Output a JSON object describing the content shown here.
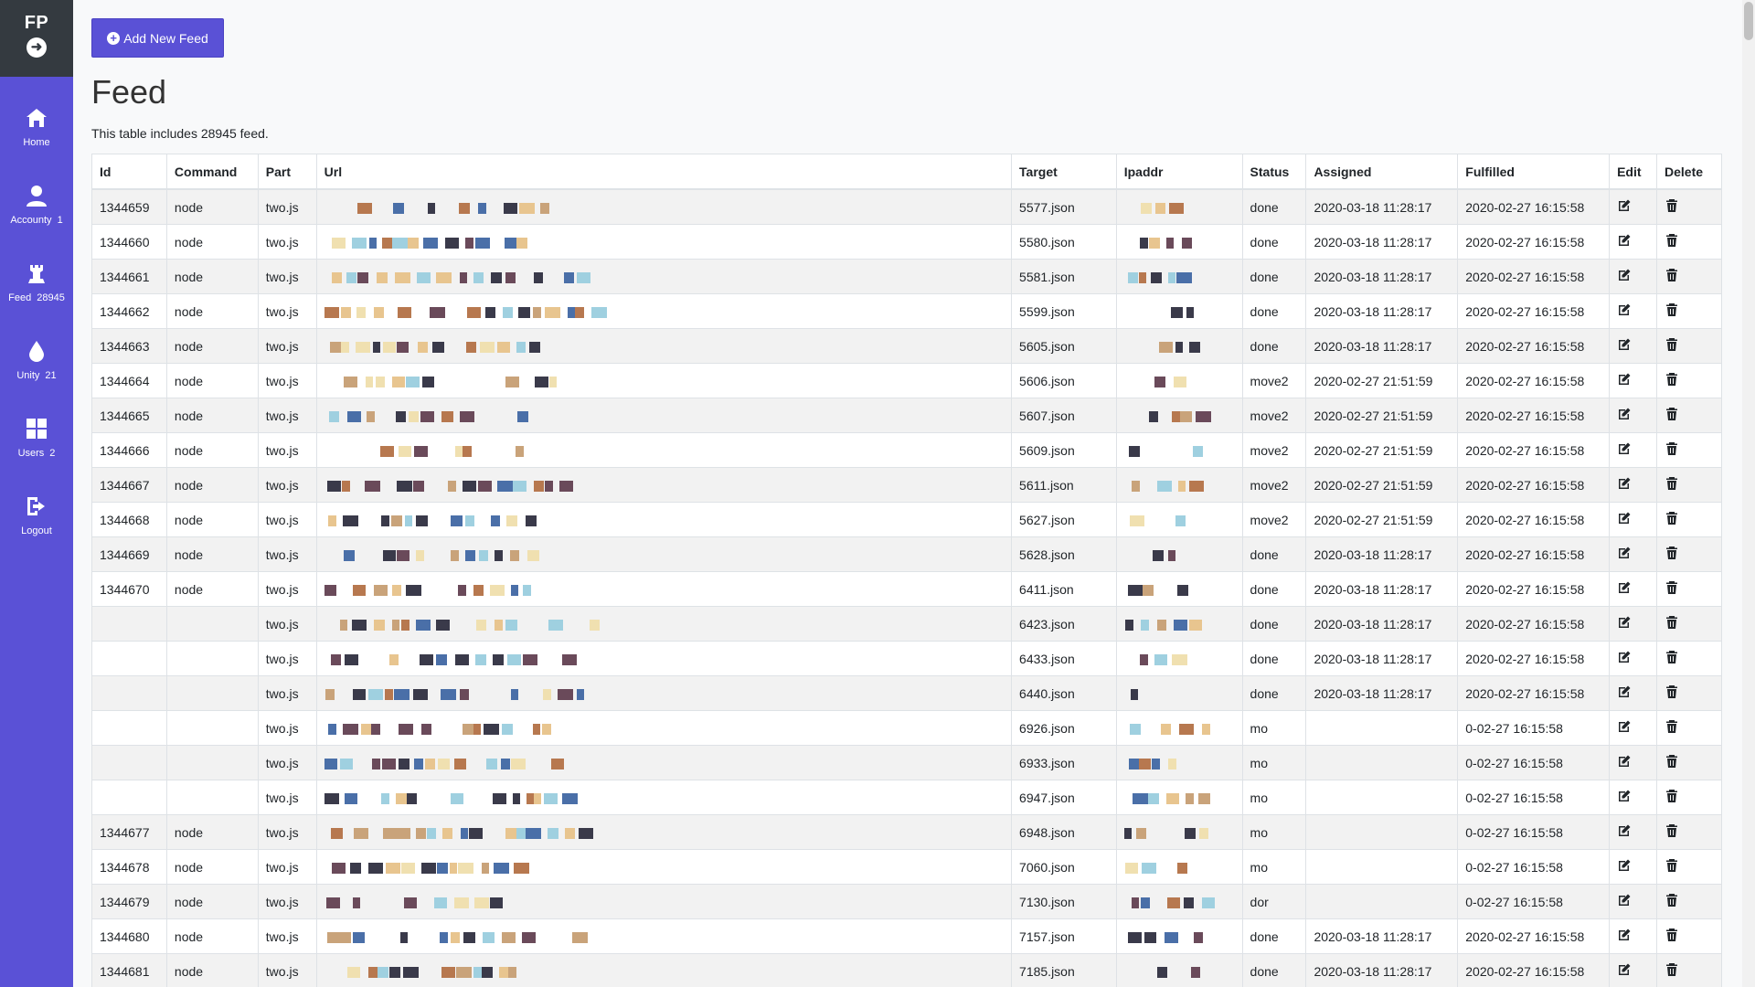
{
  "brand": {
    "title": "FP"
  },
  "nav": [
    {
      "label": "Home",
      "icon": "home-icon",
      "badge": ""
    },
    {
      "label": "Accounty",
      "icon": "user-icon",
      "badge": "1"
    },
    {
      "label": "Feed",
      "icon": "chess-rook-icon",
      "badge": "28945"
    },
    {
      "label": "Unity",
      "icon": "drop-icon",
      "badge": "21"
    },
    {
      "label": "Users",
      "icon": "grid-icon",
      "badge": "2"
    },
    {
      "label": "Logout",
      "icon": "logout-icon",
      "badge": ""
    }
  ],
  "toolbar": {
    "add_label": "Add New Feed"
  },
  "page": {
    "title": "Feed",
    "subtitle": "This table includes 28945 feed."
  },
  "table": {
    "headers": [
      "Id",
      "Command",
      "Part",
      "Url",
      "Target",
      "Ipaddr",
      "Status",
      "Assigned",
      "Fulfilled",
      "Edit",
      "Delete"
    ],
    "rows": [
      {
        "id": "1344659",
        "command": "node",
        "part": "two.js",
        "target": "5577.json",
        "status": "done",
        "assigned": "2020-03-18 11:28:17",
        "fulfilled": "2020-02-27 16:15:58"
      },
      {
        "id": "1344660",
        "command": "node",
        "part": "two.js",
        "target": "5580.json",
        "status": "done",
        "assigned": "2020-03-18 11:28:17",
        "fulfilled": "2020-02-27 16:15:58"
      },
      {
        "id": "1344661",
        "command": "node",
        "part": "two.js",
        "target": "5581.json",
        "status": "done",
        "assigned": "2020-03-18 11:28:17",
        "fulfilled": "2020-02-27 16:15:58"
      },
      {
        "id": "1344662",
        "command": "node",
        "part": "two.js",
        "target": "5599.json",
        "status": "done",
        "assigned": "2020-03-18 11:28:17",
        "fulfilled": "2020-02-27 16:15:58"
      },
      {
        "id": "1344663",
        "command": "node",
        "part": "two.js",
        "target": "5605.json",
        "status": "done",
        "assigned": "2020-03-18 11:28:17",
        "fulfilled": "2020-02-27 16:15:58"
      },
      {
        "id": "1344664",
        "command": "node",
        "part": "two.js",
        "target": "5606.json",
        "status": "move2",
        "assigned": "2020-02-27 21:51:59",
        "fulfilled": "2020-02-27 16:15:58"
      },
      {
        "id": "1344665",
        "command": "node",
        "part": "two.js",
        "target": "5607.json",
        "status": "move2",
        "assigned": "2020-02-27 21:51:59",
        "fulfilled": "2020-02-27 16:15:58"
      },
      {
        "id": "1344666",
        "command": "node",
        "part": "two.js",
        "target": "5609.json",
        "status": "move2",
        "assigned": "2020-02-27 21:51:59",
        "fulfilled": "2020-02-27 16:15:58"
      },
      {
        "id": "1344667",
        "command": "node",
        "part": "two.js",
        "target": "5611.json",
        "status": "move2",
        "assigned": "2020-02-27 21:51:59",
        "fulfilled": "2020-02-27 16:15:58"
      },
      {
        "id": "1344668",
        "command": "node",
        "part": "two.js",
        "target": "5627.json",
        "status": "move2",
        "assigned": "2020-02-27 21:51:59",
        "fulfilled": "2020-02-27 16:15:58"
      },
      {
        "id": "1344669",
        "command": "node",
        "part": "two.js",
        "target": "5628.json",
        "status": "done",
        "assigned": "2020-03-18 11:28:17",
        "fulfilled": "2020-02-27 16:15:58"
      },
      {
        "id": "1344670",
        "command": "node",
        "part": "two.js",
        "target": "6411.json",
        "status": "done",
        "assigned": "2020-03-18 11:28:17",
        "fulfilled": "2020-02-27 16:15:58"
      },
      {
        "id": "",
        "command": "",
        "part": "two.js",
        "target": "6423.json",
        "status": "done",
        "assigned": "2020-03-18 11:28:17",
        "fulfilled": "2020-02-27 16:15:58"
      },
      {
        "id": "",
        "command": "",
        "part": "two.js",
        "target": "6433.json",
        "status": "done",
        "assigned": "2020-03-18 11:28:17",
        "fulfilled": "2020-02-27 16:15:58"
      },
      {
        "id": "",
        "command": "",
        "part": "two.js",
        "target": "6440.json",
        "status": "done",
        "assigned": "2020-03-18 11:28:17",
        "fulfilled": "2020-02-27 16:15:58"
      },
      {
        "id": "",
        "command": "",
        "part": "two.js",
        "target": "6926.json",
        "status": "mo",
        "assigned": "",
        "fulfilled": "0-02-27 16:15:58"
      },
      {
        "id": "",
        "command": "",
        "part": "two.js",
        "target": "6933.json",
        "status": "mo",
        "assigned": "",
        "fulfilled": "0-02-27 16:15:58"
      },
      {
        "id": "",
        "command": "",
        "part": "two.js",
        "target": "6947.json",
        "status": "mo",
        "assigned": "",
        "fulfilled": "0-02-27 16:15:58"
      },
      {
        "id": "1344677",
        "command": "node",
        "part": "two.js",
        "target": "6948.json",
        "status": "mo",
        "assigned": "",
        "fulfilled": "0-02-27 16:15:58"
      },
      {
        "id": "1344678",
        "command": "node",
        "part": "two.js",
        "target": "7060.json",
        "status": "mo",
        "assigned": "",
        "fulfilled": "0-02-27 16:15:58"
      },
      {
        "id": "1344679",
        "command": "node",
        "part": "two.js",
        "target": "7130.json",
        "status": "dor",
        "assigned": "",
        "fulfilled": "0-02-27 16:15:58"
      },
      {
        "id": "1344680",
        "command": "node",
        "part": "two.js",
        "target": "7157.json",
        "status": "done",
        "assigned": "2020-03-18 11:28:17",
        "fulfilled": "2020-02-27 16:15:58"
      },
      {
        "id": "1344681",
        "command": "node",
        "part": "two.js",
        "target": "7185.json",
        "status": "done",
        "assigned": "2020-03-18 11:28:17",
        "fulfilled": "2020-02-27 16:15:58"
      }
    ]
  },
  "colors": {
    "sidebar": "#5a51d6",
    "brand_bg": "#343a40",
    "accent": "#5a51d6"
  }
}
